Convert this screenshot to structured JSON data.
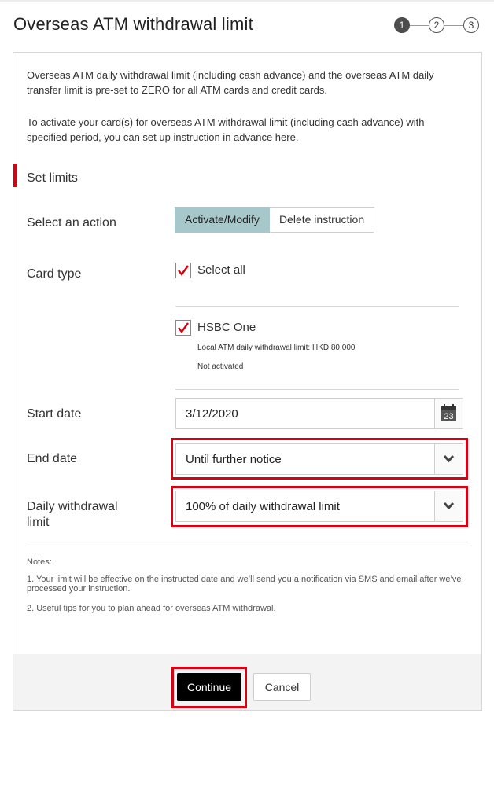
{
  "page": {
    "title": "Overseas ATM withdrawal limit",
    "steps": [
      "1",
      "2",
      "3"
    ],
    "active_step": 1
  },
  "intro": {
    "paragraph1": "Overseas ATM daily withdrawal limit (including cash advance) and the overseas ATM daily transfer limit is pre-set to ZERO for all ATM cards and credit cards.",
    "paragraph2": "To activate your card(s) for overseas ATM withdrawal limit (including cash advance) with specified period, you can set up instruction in advance here."
  },
  "section": {
    "title": "Set limits"
  },
  "action": {
    "label": "Select an action",
    "options": [
      "Activate/Modify",
      "Delete instruction"
    ],
    "selected": "Activate/Modify"
  },
  "card_type": {
    "label": "Card type",
    "select_all_label": "Select all",
    "select_all_checked": true,
    "cards": [
      {
        "name": "HSBC One",
        "checked": true,
        "limit_text": "Local ATM daily withdrawal limit: HKD 80,000",
        "status": "Not activated"
      }
    ]
  },
  "start_date": {
    "label": "Start date",
    "value": "3/12/2020",
    "calendar_day": "23",
    "icon": "calendar-icon"
  },
  "end_date": {
    "label": "End date",
    "value": "Until further notice",
    "icon": "chevron-down-icon"
  },
  "daily_limit": {
    "label_line1": "Daily withdrawal",
    "label_line2": "limit",
    "value": "100% of daily withdrawal limit",
    "icon": "chevron-down-icon"
  },
  "notes": {
    "heading": "Notes:",
    "note1": "1. Your limit will be effective on the instructed date and we’ll send you a notification via SMS and email after we’ve processed your instruction.",
    "note2_prefix": "2. Useful tips for you to plan ahead ",
    "note2_link": "for overseas ATM withdrawal."
  },
  "footer": {
    "continue_label": "Continue",
    "cancel_label": "Cancel"
  },
  "colors": {
    "highlight_red": "#db0011",
    "active_segment": "#a7c8cb",
    "primary_button": "#000000"
  }
}
